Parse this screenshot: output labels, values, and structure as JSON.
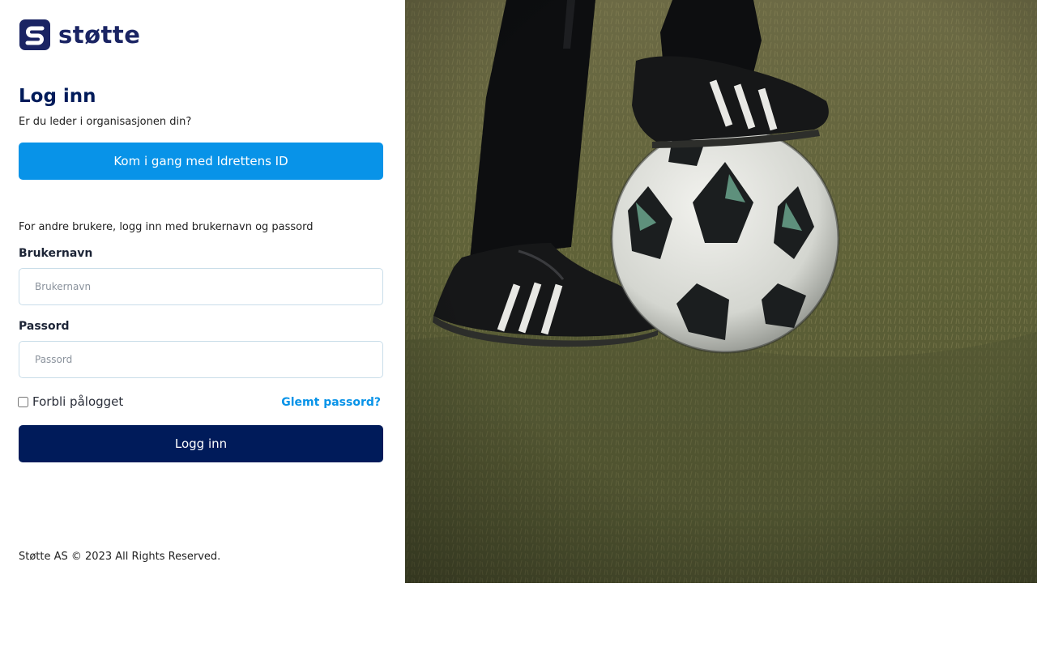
{
  "brand": {
    "name": "støtte",
    "primary_color": "#001b5a",
    "accent_color": "#0893e8"
  },
  "login": {
    "title": "Log inn",
    "subtitle": "Er du leder i organisasjonen din?",
    "id_button_label": "Kom i gang med Idrettens ID",
    "other_users_text": "For andre brukere, logg inn med brukernavn og passord",
    "username_label": "Brukernavn",
    "username_placeholder": "Brukernavn",
    "username_value": "",
    "password_label": "Passord",
    "password_placeholder": "Passord",
    "password_value": "",
    "remember_label": "Forbli pålogget",
    "remember_checked": false,
    "forgot_label": "Glemt passord?",
    "submit_label": "Logg inn"
  },
  "footer": {
    "text": "Støtte AS © 2023 All Rights Reserved."
  },
  "hero": {
    "subject": "soccer-player-foot-on-ball"
  }
}
